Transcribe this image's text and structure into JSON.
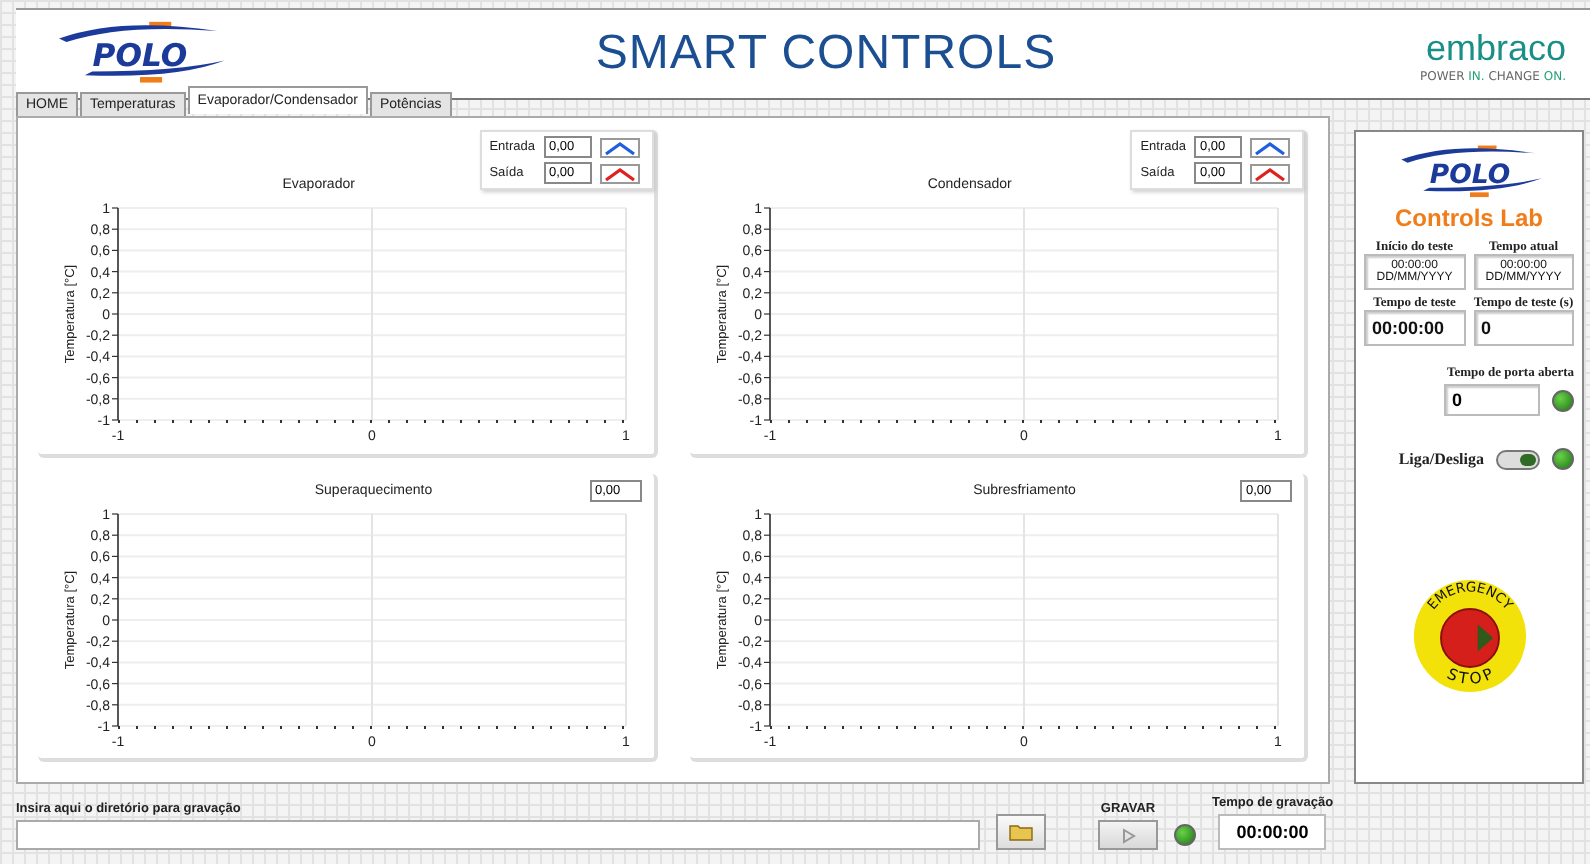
{
  "header": {
    "brand": "POLO",
    "title": "SMART CONTROLS",
    "partner": "embraco",
    "tagline": "POWER **IN.** CHANGE **ON.**"
  },
  "tabs": [
    {
      "label": "HOME",
      "selected": false
    },
    {
      "label": "Temperaturas",
      "selected": false
    },
    {
      "label": "Evaporador/Condensador",
      "selected": true
    },
    {
      "label": "Potências",
      "selected": false
    }
  ],
  "charts": [
    {
      "legend": [
        {
          "label": "Entrada",
          "value": "0,00",
          "color": "#1f5fe0"
        },
        {
          "label": "Saída",
          "value": "0,00",
          "color": "#e01f1f"
        }
      ],
      "chart_data": {
        "type": "line",
        "grid": true,
        "title": "Evaporador",
        "ylabel": "Temperatura [°C]",
        "xlim": [
          -1,
          1
        ],
        "ylim": [
          -1,
          1
        ],
        "xticks": [
          -1,
          0,
          1
        ],
        "yticks": [
          {
            "value": 1,
            "label": "1"
          },
          {
            "value": 0.8,
            "label": "0,8"
          },
          {
            "value": 0.6,
            "label": "0,6"
          },
          {
            "value": 0.4,
            "label": "0,4"
          },
          {
            "value": 0.2,
            "label": "0,2"
          },
          {
            "value": 0,
            "label": "0"
          },
          {
            "value": -0.2,
            "label": "-0,2"
          },
          {
            "value": -0.4,
            "label": "-0,4"
          },
          {
            "value": -0.6,
            "label": "-0,6"
          },
          {
            "value": -0.8,
            "label": "-0,8"
          },
          {
            "value": -1,
            "label": "-1"
          }
        ]
      }
    },
    {
      "legend": [
        {
          "label": "Entrada",
          "value": "0,00",
          "color": "#1f5fe0"
        },
        {
          "label": "Saída",
          "value": "0,00",
          "color": "#e01f1f"
        }
      ],
      "chart_data": {
        "type": "line",
        "grid": true,
        "title": "Condensador",
        "ylabel": "Temperatura [°C]",
        "xlim": [
          -1,
          1
        ],
        "ylim": [
          -1,
          1
        ],
        "xticks": [
          -1,
          0,
          1
        ],
        "yticks": [
          {
            "value": 1,
            "label": "1"
          },
          {
            "value": 0.8,
            "label": "0,8"
          },
          {
            "value": 0.6,
            "label": "0,6"
          },
          {
            "value": 0.4,
            "label": "0,4"
          },
          {
            "value": 0.2,
            "label": "0,2"
          },
          {
            "value": 0,
            "label": "0"
          },
          {
            "value": -0.2,
            "label": "-0,2"
          },
          {
            "value": -0.4,
            "label": "-0,4"
          },
          {
            "value": -0.6,
            "label": "-0,6"
          },
          {
            "value": -0.8,
            "label": "-0,8"
          },
          {
            "value": -1,
            "label": "-1"
          }
        ]
      }
    },
    {
      "value": "0,00",
      "chart_data": {
        "type": "line",
        "grid": true,
        "title": "Superaquecimento",
        "ylabel": "Temperatura [°C]",
        "xlim": [
          -1,
          1
        ],
        "ylim": [
          -1,
          1
        ],
        "xticks": [
          -1,
          0,
          1
        ],
        "yticks": [
          {
            "value": 1,
            "label": "1"
          },
          {
            "value": 0.8,
            "label": "0,8"
          },
          {
            "value": 0.6,
            "label": "0,6"
          },
          {
            "value": 0.4,
            "label": "0,4"
          },
          {
            "value": 0.2,
            "label": "0,2"
          },
          {
            "value": 0,
            "label": "0"
          },
          {
            "value": -0.2,
            "label": "-0,2"
          },
          {
            "value": -0.4,
            "label": "-0,4"
          },
          {
            "value": -0.6,
            "label": "-0,6"
          },
          {
            "value": -0.8,
            "label": "-0,8"
          },
          {
            "value": -1,
            "label": "-1"
          }
        ]
      }
    },
    {
      "value": "0,00",
      "chart_data": {
        "type": "line",
        "grid": true,
        "title": "Subresfriamento",
        "ylabel": "Temperatura [°C]",
        "xlim": [
          -1,
          1
        ],
        "ylim": [
          -1,
          1
        ],
        "xticks": [
          -1,
          0,
          1
        ],
        "yticks": [
          {
            "value": 1,
            "label": "1"
          },
          {
            "value": 0.8,
            "label": "0,8"
          },
          {
            "value": 0.6,
            "label": "0,6"
          },
          {
            "value": 0.4,
            "label": "0,4"
          },
          {
            "value": 0.2,
            "label": "0,2"
          },
          {
            "value": 0,
            "label": "0"
          },
          {
            "value": -0.2,
            "label": "-0,2"
          },
          {
            "value": -0.4,
            "label": "-0,4"
          },
          {
            "value": -0.6,
            "label": "-0,6"
          },
          {
            "value": -0.8,
            "label": "-0,8"
          },
          {
            "value": -1,
            "label": "-1"
          }
        ]
      }
    }
  ],
  "side_panel": {
    "brand": "POLO",
    "lab": "Controls Lab",
    "fields": [
      {
        "label": "Início do teste",
        "lines": [
          "00:00:00",
          "DD/MM/YYYY"
        ]
      },
      {
        "label": "Tempo atual",
        "lines": [
          "00:00:00",
          "DD/MM/YYYY"
        ]
      },
      {
        "label": "Tempo de teste",
        "lines": [
          "00:00:00"
        ]
      },
      {
        "label": "Tempo de teste (s)",
        "lines": [
          "0"
        ]
      }
    ],
    "door": {
      "label": "Tempo de porta aberta",
      "value": "0",
      "lit": true
    },
    "power": {
      "label": "Liga/Desliga",
      "on": true,
      "lit": true
    },
    "emergency": {
      "top": "EMERGENCY",
      "bottom": "STOP"
    }
  },
  "footer": {
    "path_label": "Insira aqui o diretório para gravação",
    "record_label": "GRAVAR",
    "record_lit": true,
    "time_label": "Tempo de gravação",
    "time": "00:00:00"
  }
}
